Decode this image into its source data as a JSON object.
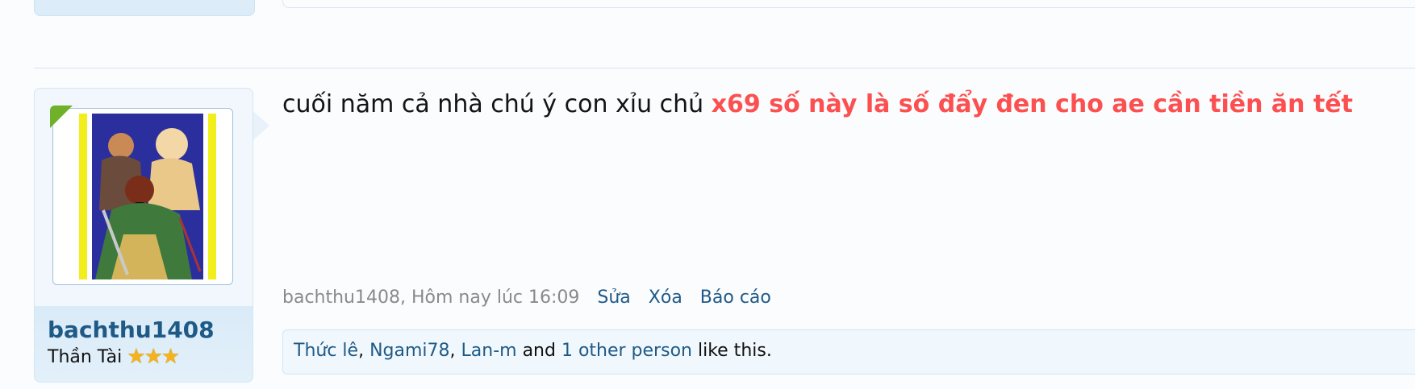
{
  "post": {
    "author": "bachthu1408",
    "user_title": "Thần Tài",
    "star_rating": 3,
    "stars_glyph": "★★★",
    "message_plain": "cuối năm cả nhà chú ý con xỉu chủ ",
    "message_highlight": "x69 số này là số đẩy đen cho ae cần tiền ăn tết",
    "highlight_color": "#fc5050",
    "meta_author_time": "bachthu1408, Hôm nay lúc 16:09",
    "edit_label": "Sửa",
    "delete_label": "Xóa",
    "report_label": "Báo cáo",
    "likes": {
      "user1": "Thức lê",
      "sep1": ", ",
      "user2": "Ngami78",
      "sep2": ", ",
      "user3": "Lan-m",
      "and": " and ",
      "others": "1 other person",
      "suffix": " like this."
    }
  },
  "colors": {
    "link": "#1f5a87",
    "online": "#6fb22a"
  }
}
